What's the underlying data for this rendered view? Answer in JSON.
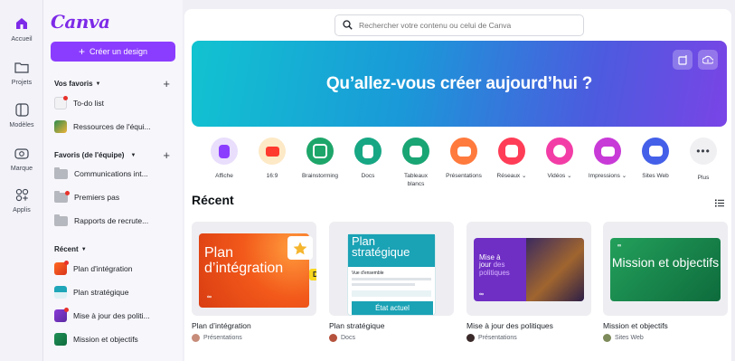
{
  "rail": {
    "items": [
      {
        "label": "Accueil",
        "icon": "home-icon"
      },
      {
        "label": "Projets",
        "icon": "folder-icon"
      },
      {
        "label": "Modèles",
        "icon": "templates-icon"
      },
      {
        "label": "Marque",
        "icon": "brand-icon"
      },
      {
        "label": "Applis",
        "icon": "apps-icon"
      }
    ]
  },
  "panel": {
    "brand": "Canva",
    "create_button": "Créer un design",
    "favorites_heading": "Vos favoris",
    "favorites": [
      "To-do list",
      "Ressources de l'équi..."
    ],
    "team_heading": "Favoris (de l'équipe)",
    "team": [
      "Communications int...",
      "Premiers pas",
      "Rapports de recrute..."
    ],
    "recent_heading": "Récent",
    "recent": [
      "Plan d'intégration",
      "Plan stratégique",
      "Mise à jour des politi...",
      "Mission et objectifs"
    ]
  },
  "search": {
    "placeholder": "Rechercher votre contenu ou celui de Canva"
  },
  "hero": {
    "title": "Qu’allez-vous créer aujourd’hui ?",
    "gradient": [
      "#11c3d0",
      "#4c5bdf",
      "#7a44e6"
    ]
  },
  "categories": [
    {
      "label": "Affiche",
      "color": "#e9defc",
      "icon": "poster-icon"
    },
    {
      "label": "16:9",
      "color": "#fde9c6",
      "icon": "youtube-icon"
    },
    {
      "label": "Brainstorming",
      "color": "#1ea66a",
      "icon": "brainstorm-icon"
    },
    {
      "label": "Docs",
      "color": "#17a784",
      "icon": "docs-icon"
    },
    {
      "label": "Tableaux blancs",
      "color": "#1aa574",
      "icon": "whiteboard-icon"
    },
    {
      "label": "Présentations",
      "color": "#ff7a3d",
      "icon": "presentation-icon"
    },
    {
      "label": "Réseaux",
      "color": "#ff3d57",
      "icon": "social-icon"
    },
    {
      "label": "Vidéos",
      "color": "#f33da6",
      "icon": "video-icon"
    },
    {
      "label": "Impressions",
      "color": "#c83ad7",
      "icon": "print-icon"
    },
    {
      "label": "Sites Web",
      "color": "#4460e9",
      "icon": "website-icon"
    },
    {
      "label": "Plus",
      "color": "#f0f0f3",
      "icon": "more-icon"
    }
  ],
  "recent": {
    "title": "Récent",
    "cards": [
      {
        "title": "Plan d’intégration",
        "type": "Présentations",
        "thumb_text": "Plan d’intégration",
        "collaborator": "David"
      },
      {
        "title": "Plan stratégique",
        "type": "Docs",
        "thumb_text": "Plan stratégique",
        "thumb_sub": "Vue d'ensemble",
        "thumb_button": "État actuel"
      },
      {
        "title": "Mise à jour des politiques",
        "type": "Présentations",
        "thumb_text_1": "Mise à",
        "thumb_text_2": "jour",
        "thumb_text_3": "des",
        "thumb_text_4": "politiques"
      },
      {
        "title": "Mission et objectifs",
        "type": "Sites Web",
        "thumb_text": "Mission et objectifs"
      }
    ]
  },
  "colors": {
    "accent": "#8b3dff",
    "brand": "#7d2ae8"
  }
}
